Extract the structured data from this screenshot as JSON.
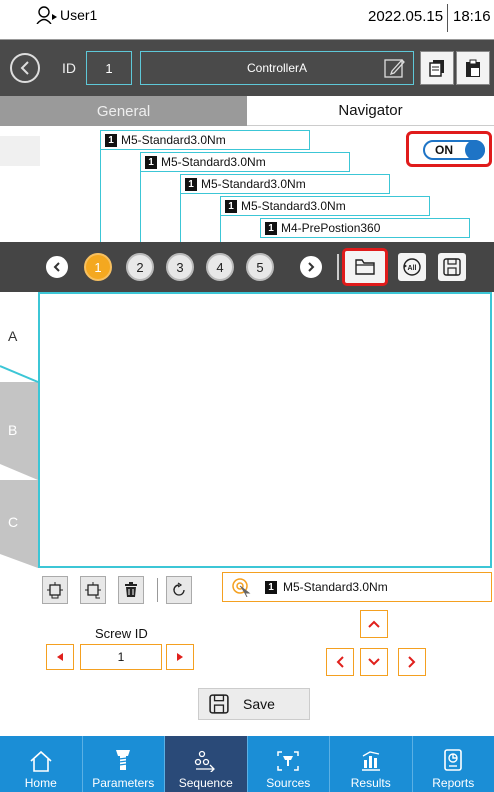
{
  "status": {
    "user": "User1",
    "date": "2022.05.15",
    "time": "18:16"
  },
  "header": {
    "id_label": "ID",
    "id_value": "1",
    "controller_name": "ControllerA"
  },
  "tabs": [
    {
      "label": "General",
      "active": false
    },
    {
      "label": "Navigator",
      "active": true
    }
  ],
  "tree": {
    "nodes": [
      {
        "num": "1",
        "label": "M5-Standard3.0Nm"
      },
      {
        "num": "1",
        "label": "M5-Standard3.0Nm"
      },
      {
        "num": "1",
        "label": "M5-Standard3.0Nm"
      },
      {
        "num": "1",
        "label": "M5-Standard3.0Nm"
      },
      {
        "num": "1",
        "label": "M4-PrePostion360"
      }
    ],
    "toggle_label": "ON"
  },
  "steps": [
    "1",
    "2",
    "3",
    "4",
    "5"
  ],
  "active_step": "1",
  "side_tabs": [
    "A",
    "B",
    "C"
  ],
  "current_node": {
    "num": "1",
    "label": "M5-Standard3.0Nm"
  },
  "screw": {
    "label": "Screw ID",
    "value": "1"
  },
  "save_label": "Save",
  "footer": [
    "Home",
    "Parameters",
    "Sequence",
    "Sources",
    "Results",
    "Reports"
  ],
  "active_footer": "Sequence",
  "colors": {
    "accent_cyan": "#3cc6d6",
    "accent_orange": "#f4a020",
    "highlight_red": "#e01b1b",
    "footer_blue": "#1b8ed6",
    "footer_active": "#2a4a78"
  }
}
